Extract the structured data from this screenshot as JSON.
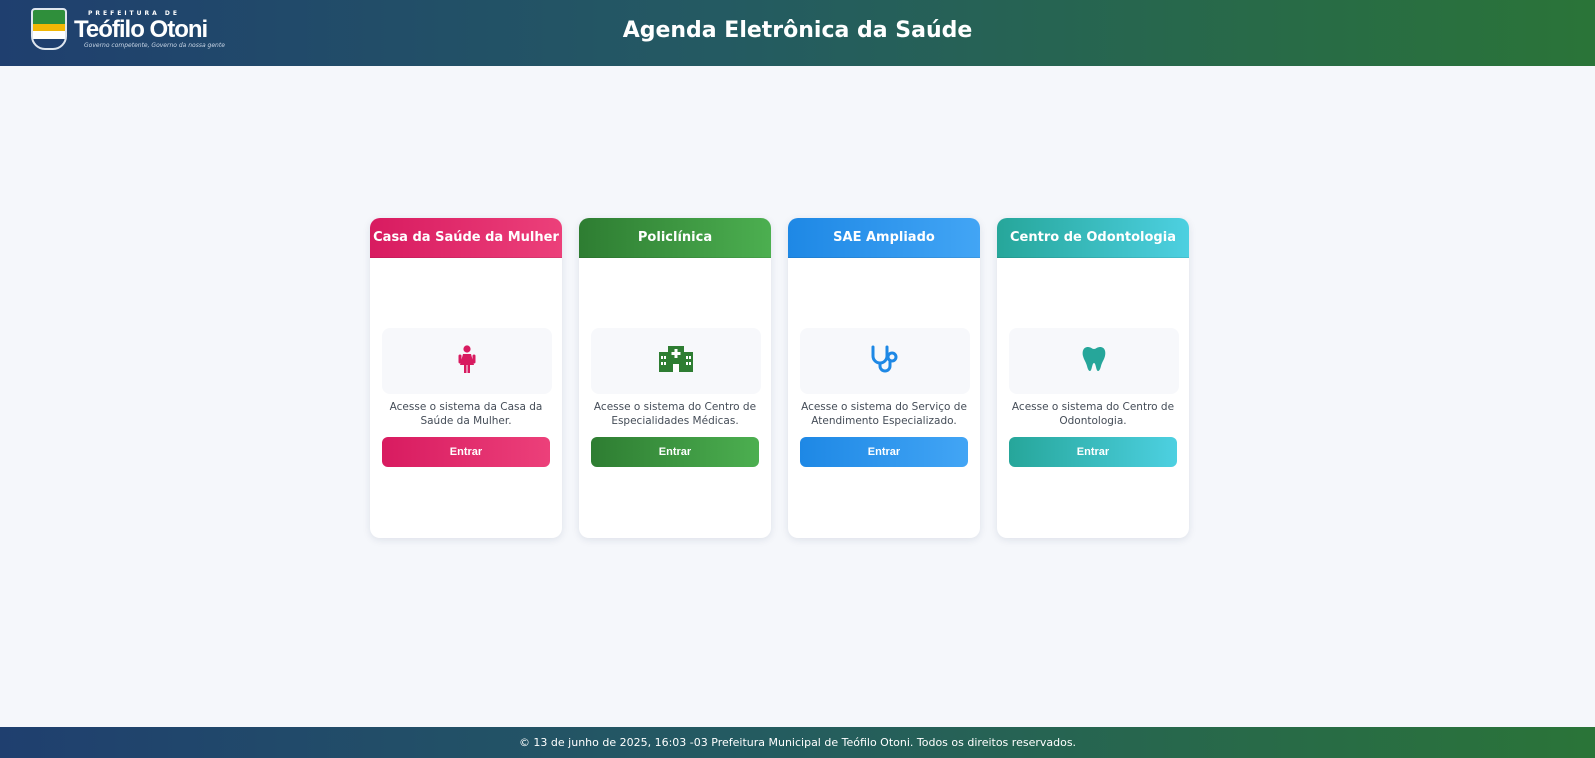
{
  "header": {
    "logo": {
      "small_text": "PREFEITURA DE",
      "city": "Teófilo Otoni",
      "tagline": "Governo competente, Governo da nossa gente"
    },
    "title": "Agenda Eletrônica da Saúde"
  },
  "cards": [
    {
      "title": "Casa da Saúde da Mulher",
      "icon": "female-person-icon",
      "description": "Acesse o sistema da Casa da Saúde da Mulher.",
      "button": "Entrar",
      "color_start": "#d81b60",
      "color_end": "#ec407a"
    },
    {
      "title": "Policlínica",
      "icon": "hospital-building-icon",
      "description": "Acesse o sistema do Centro de Especialidades Médicas.",
      "button": "Entrar",
      "color_start": "#2e7d32",
      "color_end": "#4caf50"
    },
    {
      "title": "SAE Ampliado",
      "icon": "stethoscope-icon",
      "description": "Acesse o sistema do Serviço de Atendimento Especializado.",
      "button": "Entrar",
      "color_start": "#1e88e5",
      "color_end": "#42a5f5"
    },
    {
      "title": "Centro de Odontologia",
      "icon": "tooth-icon",
      "description": "Acesse o sistema do Centro de Odontologia.",
      "button": "Entrar",
      "color_start": "#26a69a",
      "color_end": "#4dd0e1"
    }
  ],
  "footer": {
    "text": "© 13 de junho de 2025, 16:03 -03 Prefeitura Municipal de Teófilo Otoni. Todos os direitos reservados."
  }
}
